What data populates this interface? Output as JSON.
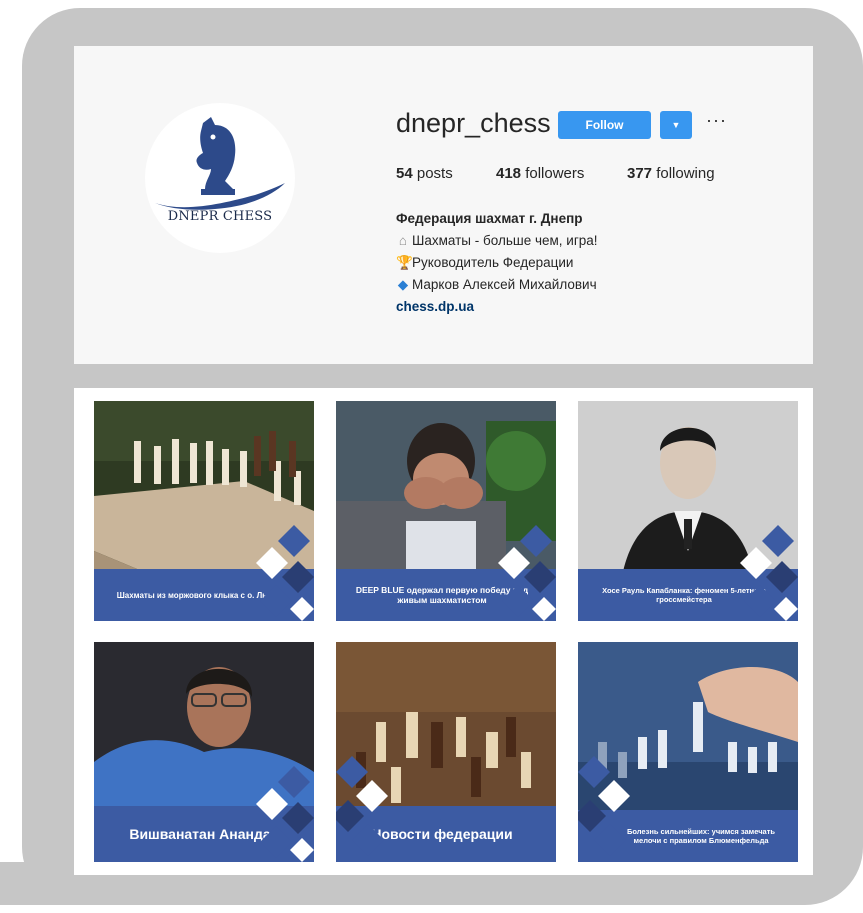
{
  "profile": {
    "avatar_text": "DNEPR CHESS",
    "username": "dnepr_chess",
    "follow_label": "Follow",
    "dropdown_label": "▼",
    "more_label": "···",
    "stats": [
      {
        "count": "54",
        "label": "posts"
      },
      {
        "count": "418",
        "label": "followers"
      },
      {
        "count": "377",
        "label": "following"
      }
    ],
    "bio": {
      "name": "Федерация шахмат г. Днепр",
      "line1": "Шахматы - больше чем, игра!",
      "line2": "Руководитель Федерации",
      "line3": "Марков Алексей Михайлович",
      "link": "chess.dp.ua"
    }
  },
  "posts": [
    {
      "caption": "Шахматы из моржового клыка с о. Льюис"
    },
    {
      "caption": "DEEP BLUE одержал первую победу над живым шахматистом"
    },
    {
      "caption": "Хосе Рауль Капабланка: феномен 5-летнего гроссмейстера"
    },
    {
      "caption": "Вишванатан Ананда"
    },
    {
      "caption": "Новости федерации"
    },
    {
      "caption": "Болезнь сильнейших: учимся замечать мелочи с правилом Блюменфельда"
    }
  ],
  "colors": {
    "accent": "#3897f0",
    "brand_blue": "#3c5ba3",
    "frame": "#c6c6c6"
  }
}
